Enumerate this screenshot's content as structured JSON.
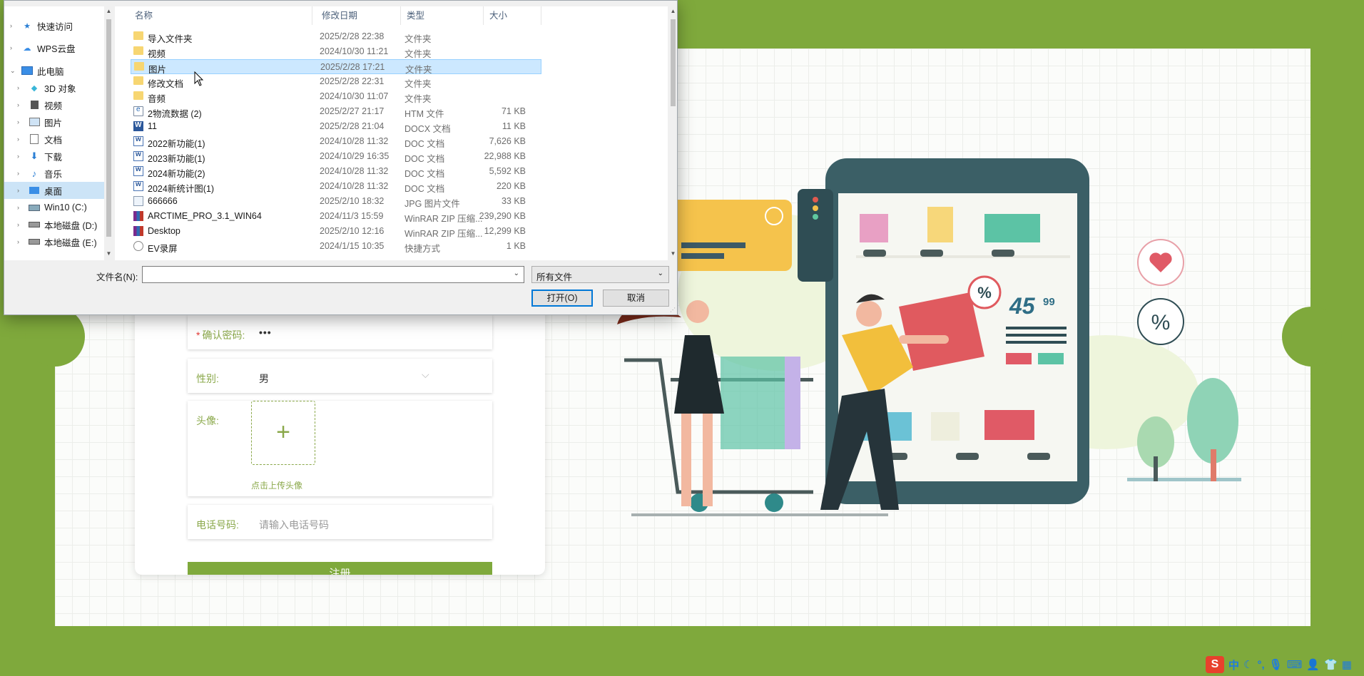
{
  "form": {
    "confirm_password_label": "确认密码:",
    "confirm_password_value": "•••",
    "gender_label": "性别:",
    "gender_value": "男",
    "avatar_label": "头像:",
    "upload_plus": "+",
    "upload_hint": "点击上传头像",
    "phone_label": "电话号码:",
    "phone_placeholder": "请输入电话号码",
    "register_button": "注册",
    "accent_color": "#7fa93c"
  },
  "illustration": {
    "percent_badge": "%",
    "price_main": "45",
    "price_cents": "99",
    "percent_circle": "%"
  },
  "dialog": {
    "nav": [
      {
        "label": "快速访问",
        "icon": "star-icon"
      },
      {
        "label": "WPS云盘",
        "icon": "cloud-icon"
      },
      {
        "label": "此电脑",
        "icon": "computer-icon"
      },
      {
        "label": "3D 对象",
        "icon": "cube-icon"
      },
      {
        "label": "视频",
        "icon": "video-icon"
      },
      {
        "label": "图片",
        "icon": "picture-icon"
      },
      {
        "label": "文档",
        "icon": "document-icon"
      },
      {
        "label": "下载",
        "icon": "download-icon"
      },
      {
        "label": "音乐",
        "icon": "music-icon"
      },
      {
        "label": "桌面",
        "icon": "desktop-icon"
      },
      {
        "label": "Win10 (C:)",
        "icon": "drive-icon"
      },
      {
        "label": "本地磁盘 (D:)",
        "icon": "drive-icon"
      },
      {
        "label": "本地磁盘 (E:)",
        "icon": "drive-icon"
      }
    ],
    "columns": {
      "name": "名称",
      "date": "修改日期",
      "type": "类型",
      "size": "大小"
    },
    "files": [
      {
        "name": "导入文件夹",
        "date": "2025/2/28 22:38",
        "type": "文件夹",
        "size": "",
        "icon": "folder-icon"
      },
      {
        "name": "视频",
        "date": "2024/10/30 11:21",
        "type": "文件夹",
        "size": "",
        "icon": "folder-icon"
      },
      {
        "name": "图片",
        "date": "2025/2/28 17:21",
        "type": "文件夹",
        "size": "",
        "icon": "folder-icon"
      },
      {
        "name": "修改文档",
        "date": "2025/2/28 22:31",
        "type": "文件夹",
        "size": "",
        "icon": "folder-icon"
      },
      {
        "name": "音频",
        "date": "2024/10/30 11:07",
        "type": "文件夹",
        "size": "",
        "icon": "folder-icon"
      },
      {
        "name": "2物流数据 (2)",
        "date": "2025/2/27 21:17",
        "type": "HTM 文件",
        "size": "71 KB",
        "icon": "htm-icon"
      },
      {
        "name": "11",
        "date": "2025/2/28 21:04",
        "type": "DOCX 文档",
        "size": "11 KB",
        "icon": "docx-icon"
      },
      {
        "name": "2022新功能(1)",
        "date": "2024/10/28 11:32",
        "type": "DOC 文档",
        "size": "7,626 KB",
        "icon": "doc-icon"
      },
      {
        "name": "2023新功能(1)",
        "date": "2024/10/29 16:35",
        "type": "DOC 文档",
        "size": "22,988 KB",
        "icon": "doc-icon"
      },
      {
        "name": "2024新功能(2)",
        "date": "2024/10/28 11:32",
        "type": "DOC 文档",
        "size": "5,592 KB",
        "icon": "doc-icon"
      },
      {
        "name": "2024新统计图(1)",
        "date": "2024/10/28 11:32",
        "type": "DOC 文档",
        "size": "220 KB",
        "icon": "doc-icon"
      },
      {
        "name": "666666",
        "date": "2025/2/10 18:32",
        "type": "JPG 图片文件",
        "size": "33 KB",
        "icon": "jpg-icon"
      },
      {
        "name": "ARCTIME_PRO_3.1_WIN64",
        "date": "2024/11/3 15:59",
        "type": "WinRAR ZIP 压缩...",
        "size": "239,290 KB",
        "icon": "rar-icon"
      },
      {
        "name": "Desktop",
        "date": "2025/2/10 12:16",
        "type": "WinRAR ZIP 压缩...",
        "size": "12,299 KB",
        "icon": "rar-icon"
      },
      {
        "name": "EV录屏",
        "date": "2024/1/15 10:35",
        "type": "快捷方式",
        "size": "1 KB",
        "icon": "lnk-icon"
      }
    ],
    "selected_file": "图片",
    "filename_label": "文件名(N):",
    "filename_value": "",
    "filter_value": "所有文件",
    "open_button": "打开(O)",
    "cancel_button": "取消"
  },
  "ime": {
    "logo": "S",
    "mode": "中"
  }
}
